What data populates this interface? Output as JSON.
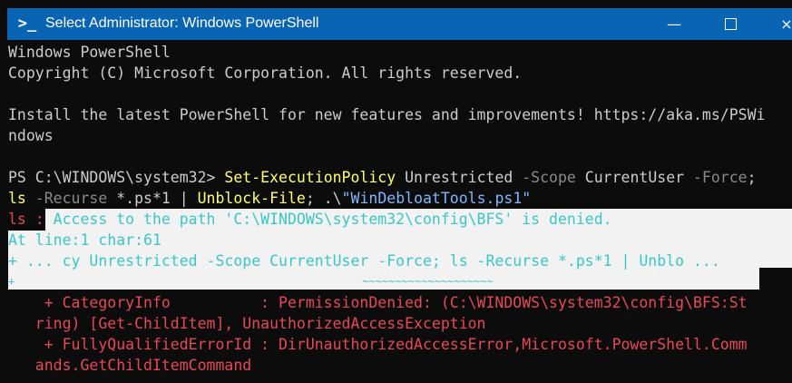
{
  "window": {
    "title": "Select Administrator: Windows PowerShell",
    "icon": "powershell-icon",
    "titlebar_color": "#0a64b4",
    "controls": {
      "minimize": "—",
      "maximize": "maximize-icon",
      "close": "×"
    }
  },
  "console": {
    "header_line1": "Windows PowerShell",
    "header_line2": "Copyright (C) Microsoft Corporation. All rights reserved.",
    "install_line1": "Install the latest PowerShell for new features and improvements! https://aka.ms/PSWi",
    "install_line2": "ndows",
    "command_line1": [
      {
        "t": "PS C:\\WINDOWS\\system32> ",
        "c": "plain"
      },
      {
        "t": "Set-ExecutionPolicy",
        "c": "cmd"
      },
      {
        "t": " Unrestricted ",
        "c": "plain"
      },
      {
        "t": "-Scope",
        "c": "param"
      },
      {
        "t": " CurrentUser ",
        "c": "plain"
      },
      {
        "t": "-Force",
        "c": "param"
      },
      {
        "t": ";",
        "c": "plain"
      }
    ],
    "command_line2": [
      {
        "t": "ls",
        "c": "cmd"
      },
      {
        "t": " -Recurse ",
        "c": "param"
      },
      {
        "t": "*.ps*1 | ",
        "c": "plain"
      },
      {
        "t": "Unblock-File",
        "c": "cmd"
      },
      {
        "t": "; .\\",
        "c": "plain"
      },
      {
        "t": "\"WinDebloatTools.ps1\"",
        "c": "str"
      }
    ],
    "error_prefix": "ls : ",
    "error_message": "Access to the path 'C:\\WINDOWS\\system32\\config\\BFS' is denied.",
    "at_line": "At line:1 char:61",
    "context_line": "+ ... cy Unrestricted -Scope CurrentUser -Force; ls -Recurse *.ps*1 | Unblo ...",
    "squiggle_line": "+                                                     ~~~~~~~~~~~~~~~~~~~~",
    "category_info_1": "    + CategoryInfo          : PermissionDenied: (C:\\WINDOWS\\system32\\config\\BFS:St",
    "category_info_2": "   ring) [Get-ChildItem], UnauthorizedAccessException",
    "fqid_1": "    + FullyQualifiedErrorId : DirUnauthorizedAccessError,Microsoft.PowerShell.Comm",
    "fqid_2": "   ands.GetChildItemCommand",
    "colors": {
      "background": "#0c0c0c",
      "text": "#cccccc",
      "command": "#ffff72",
      "parameter": "#8a8a8a",
      "string": "#7fb7ff",
      "error": "#e74856",
      "selected_text": "#3ac7c7",
      "selection_bg": "#f2f2f2"
    }
  }
}
